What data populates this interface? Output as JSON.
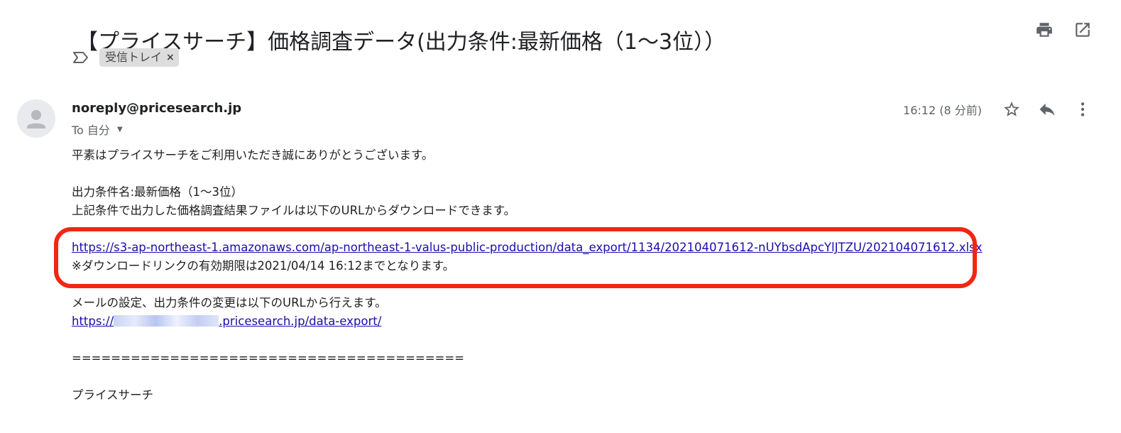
{
  "email": {
    "subject": "【プライスサーチ】価格調査データ(出力条件:最新価格（1〜3位））",
    "label": "受信トレイ",
    "label_remove": "×",
    "sender": "noreply@pricesearch.jp",
    "recipient": "To 自分",
    "timestamp": "16:12 (8 分前)",
    "body": {
      "greeting": "平素はプライスサーチをご利用いただき誠にありがとうございます。",
      "condition_name": "出力条件名:最新価格（1〜3位）",
      "download_note": "上記条件で出力した価格調査結果ファイルは以下のURLからダウンロードできます。",
      "download_url": "https://s3-ap-northeast-1.amazonaws.com/ap-northeast-1-valus-public-production/data_export/1134/202104071612-nUYbsdApcYlJTZU/202104071612.xlsx",
      "expiry_note": "※ダウンロードリンクの有効期限は2021/04/14 16:12までとなります。",
      "settings_note": "メールの設定、出力条件の変更は以下のURLから行えます。",
      "settings_url_prefix": "https://",
      "settings_url_suffix": ".pricesearch.jp/data-export/",
      "divider": "========================================",
      "signature": "プライスサーチ"
    }
  },
  "colors": {
    "link": "#1a0dab",
    "highlight": "#f22614",
    "chip_bg": "#dddddd",
    "icon": "#5f6368"
  },
  "icons": {
    "print": "print-icon",
    "open_in_new": "open-in-new-window-icon",
    "label": "label-icon",
    "star": "star-icon",
    "reply": "reply-icon",
    "more": "more-vertical-icon",
    "avatar": "default-avatar-icon"
  }
}
